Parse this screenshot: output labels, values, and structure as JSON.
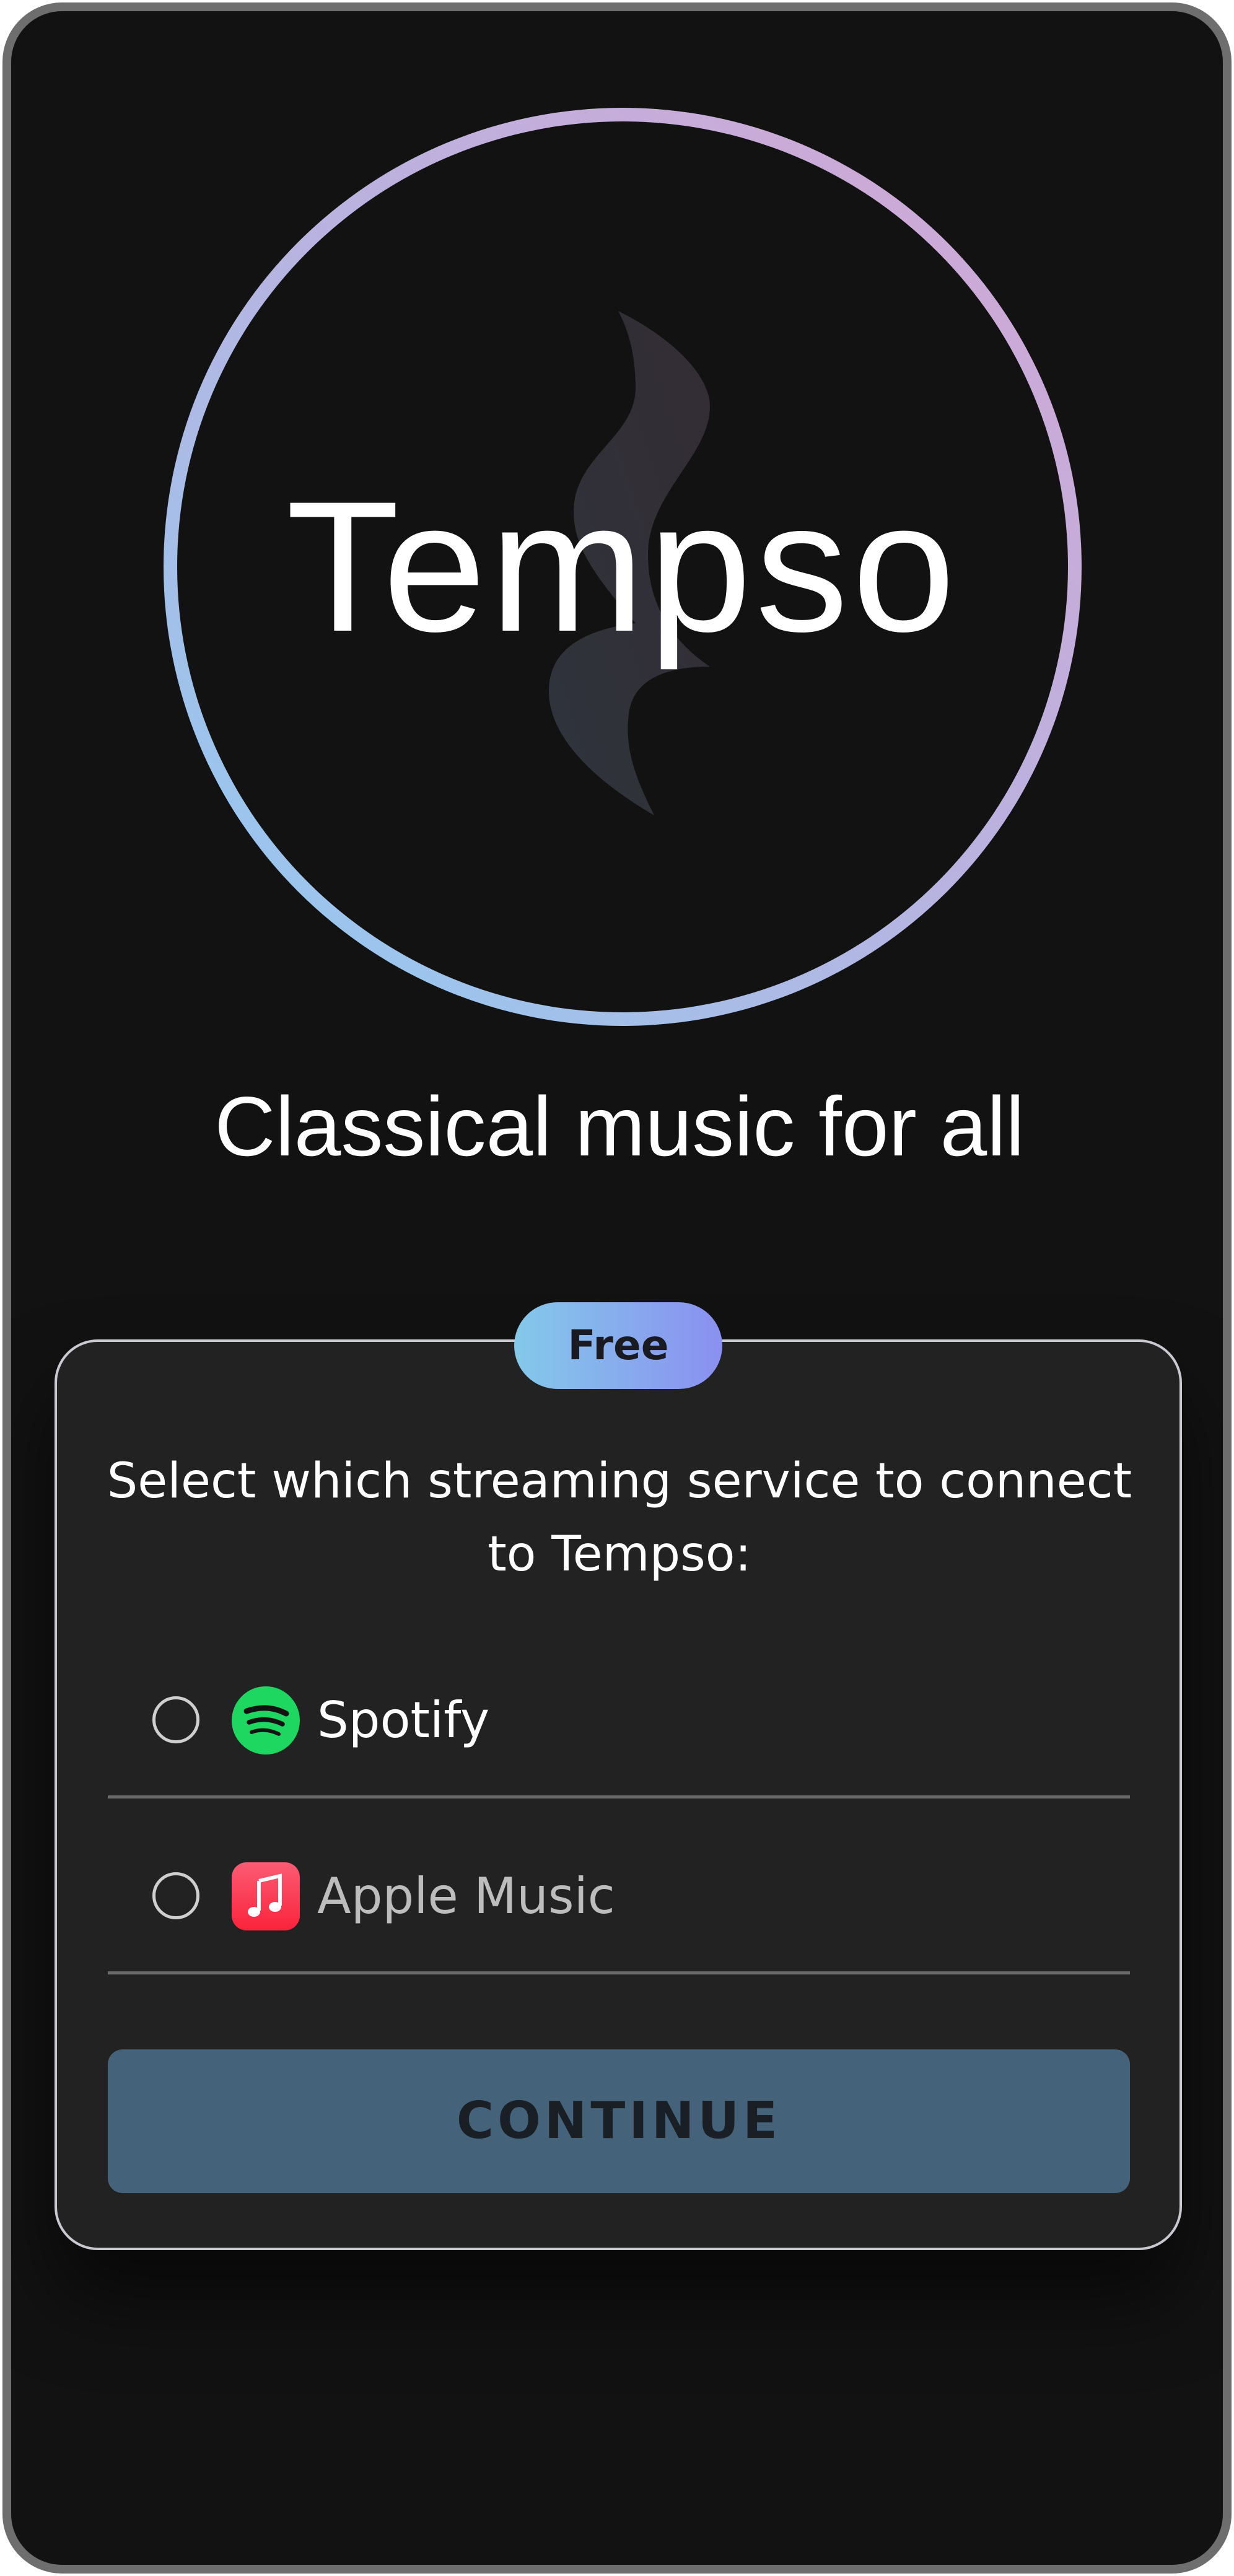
{
  "logo": {
    "wordmark": "Tempso",
    "icon": "music-swirl-icon"
  },
  "tagline": "Classical music for all",
  "card": {
    "badge": "Free",
    "prompt_line1": "Select which streaming service to connect",
    "prompt_line2": "to Tempso:",
    "options": [
      {
        "label": "Spotify",
        "icon": "spotify-icon",
        "selected": false,
        "label_color": "#ffffff"
      },
      {
        "label": "Apple Music",
        "icon": "apple-music-icon",
        "selected": false,
        "label_color": "#bdbdbd"
      }
    ],
    "continue_label": "CONTINUE"
  },
  "colors": {
    "background": "#121212",
    "card": "#222222",
    "button": "#45627b",
    "spotify_green": "#1ed760",
    "apple_music_red": "#fa3b50"
  }
}
